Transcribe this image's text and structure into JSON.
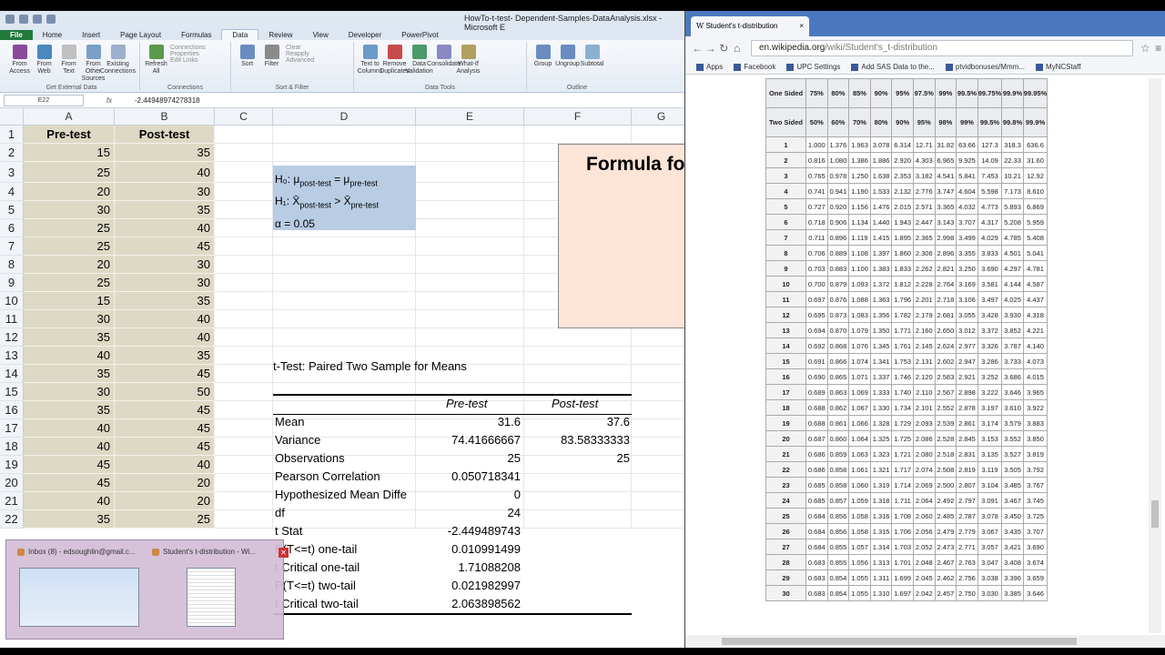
{
  "excel": {
    "title": "HowTo-t-test- Dependent-Samples-DataAnalysis.xlsx - Microsoft E",
    "tabs": [
      "File",
      "Home",
      "Insert",
      "Page Layout",
      "Formulas",
      "Data",
      "Review",
      "View",
      "Developer",
      "PowerPivot"
    ],
    "ribbon": {
      "get_external": [
        "From Access",
        "From Web",
        "From Text",
        "From Other Sources",
        "Existing Connections"
      ],
      "get_external_label": "Get External Data",
      "refresh": "Refresh All",
      "connections": [
        "Connections",
        "Properties",
        "Edit Links"
      ],
      "connections_label": "Connections",
      "sort": "Sort",
      "filter": "Filter",
      "filter_small": [
        "Clear",
        "Reapply",
        "Advanced"
      ],
      "sort_label": "Sort & Filter",
      "tools": [
        "Text to Columns",
        "Remove Duplicates",
        "Data Validation",
        "Consolidate",
        "What-If Analysis"
      ],
      "tools_label": "Data Tools",
      "outline": [
        "Group",
        "Ungroup",
        "Subtotal"
      ],
      "outline_label": "Outline"
    },
    "namebox": "E22",
    "fx": "fx",
    "formula": "-2.44948974278318",
    "columns": [
      "A",
      "B",
      "C",
      "D",
      "E",
      "F",
      "G"
    ],
    "rows": [
      "1",
      "2",
      "3",
      "4",
      "5",
      "6",
      "7",
      "8",
      "9",
      "10",
      "11",
      "12",
      "13",
      "14",
      "15",
      "16",
      "17",
      "18",
      "19",
      "20",
      "21",
      "22"
    ],
    "col_a_header": "Pre-test",
    "col_b_header": "Post-test",
    "pre": [
      "15",
      "25",
      "20",
      "30",
      "25",
      "25",
      "20",
      "25",
      "15",
      "30",
      "35",
      "40",
      "35",
      "30",
      "35",
      "40",
      "40",
      "45",
      "45",
      "40",
      "35"
    ],
    "post": [
      "35",
      "40",
      "30",
      "35",
      "40",
      "45",
      "30",
      "30",
      "35",
      "40",
      "40",
      "35",
      "45",
      "50",
      "45",
      "45",
      "45",
      "40",
      "20",
      "20",
      "25"
    ],
    "hyp": {
      "h0": "H₀: μ",
      "h0_sub1": "post-test",
      "h0_mid": " = μ",
      "h0_sub2": "pre-test",
      "h1": "H₁: X̄",
      "h1_sub1": "post-test",
      "h1_mid": " > X̄",
      "h1_sub2": "pre-test",
      "alpha": "α = 0.05"
    },
    "formula_box": "Formula for",
    "ttest_title": "t-Test: Paired Two Sample for Means",
    "ttest_cols": [
      "Pre-test",
      "Post-test"
    ],
    "ttest_rows": [
      {
        "label": "Mean",
        "pre": "31.6",
        "post": "37.6"
      },
      {
        "label": "Variance",
        "pre": "74.41666667",
        "post": "83.58333333"
      },
      {
        "label": "Observations",
        "pre": "25",
        "post": "25"
      },
      {
        "label": "Pearson Correlation",
        "pre": "0.050718341",
        "post": ""
      },
      {
        "label": "Hypothesized Mean Diffe",
        "pre": "0",
        "post": ""
      },
      {
        "label": "df",
        "pre": "24",
        "post": ""
      },
      {
        "label": "t Stat",
        "pre": "-2.449489743",
        "post": ""
      },
      {
        "label": "P(T<=t) one-tail",
        "pre": "0.010991499",
        "post": ""
      },
      {
        "label": "t Critical one-tail",
        "pre": "1.71088208",
        "post": ""
      },
      {
        "label": "P(T<=t) two-tail",
        "pre": "0.021982997",
        "post": ""
      },
      {
        "label": "t Critical two-tail",
        "pre": "2.063898562",
        "post": ""
      }
    ]
  },
  "taskbar_preview": [
    {
      "title": "Inbox (8) - edsoughlin@gmail.c..."
    },
    {
      "title": "Student's t-distribution - Wi..."
    }
  ],
  "chrome": {
    "tab_title": "Student's t-distribution",
    "url_domain": "en.wikipedia.org",
    "url_path": "/wiki/Student's_t-distribution",
    "bookmarks": [
      "Apps",
      "Facebook",
      "UPC Settings",
      "Add SAS Data to the...",
      "ptvidbonuses/Mmm...",
      "MyNCStaff"
    ],
    "one_sided_label": "One Sided",
    "two_sided_label": "Two Sided",
    "one_sided": [
      "75%",
      "80%",
      "85%",
      "90%",
      "95%",
      "97.5%",
      "99%",
      "99.5%",
      "99.75%",
      "99.9%",
      "99.95%"
    ],
    "two_sided": [
      "50%",
      "60%",
      "70%",
      "80%",
      "90%",
      "95%",
      "98%",
      "99%",
      "99.5%",
      "99.8%",
      "99.9%"
    ],
    "table": [
      [
        "1",
        "1.000",
        "1.376",
        "1.963",
        "3.078",
        "6.314",
        "12.71",
        "31.82",
        "63.66",
        "127.3",
        "318.3",
        "636.6"
      ],
      [
        "2",
        "0.816",
        "1.080",
        "1.386",
        "1.886",
        "2.920",
        "4.303",
        "6.965",
        "9.925",
        "14.09",
        "22.33",
        "31.60"
      ],
      [
        "3",
        "0.765",
        "0.978",
        "1.250",
        "1.638",
        "2.353",
        "3.182",
        "4.541",
        "5.841",
        "7.453",
        "10.21",
        "12.92"
      ],
      [
        "4",
        "0.741",
        "0.941",
        "1.190",
        "1.533",
        "2.132",
        "2.776",
        "3.747",
        "4.604",
        "5.598",
        "7.173",
        "8.610"
      ],
      [
        "5",
        "0.727",
        "0.920",
        "1.156",
        "1.476",
        "2.015",
        "2.571",
        "3.365",
        "4.032",
        "4.773",
        "5.893",
        "6.869"
      ],
      [
        "6",
        "0.718",
        "0.906",
        "1.134",
        "1.440",
        "1.943",
        "2.447",
        "3.143",
        "3.707",
        "4.317",
        "5.208",
        "5.959"
      ],
      [
        "7",
        "0.711",
        "0.896",
        "1.119",
        "1.415",
        "1.895",
        "2.365",
        "2.998",
        "3.499",
        "4.029",
        "4.785",
        "5.408"
      ],
      [
        "8",
        "0.706",
        "0.889",
        "1.108",
        "1.397",
        "1.860",
        "2.306",
        "2.896",
        "3.355",
        "3.833",
        "4.501",
        "5.041"
      ],
      [
        "9",
        "0.703",
        "0.883",
        "1.100",
        "1.383",
        "1.833",
        "2.262",
        "2.821",
        "3.250",
        "3.690",
        "4.297",
        "4.781"
      ],
      [
        "10",
        "0.700",
        "0.879",
        "1.093",
        "1.372",
        "1.812",
        "2.228",
        "2.764",
        "3.169",
        "3.581",
        "4.144",
        "4.587"
      ],
      [
        "11",
        "0.697",
        "0.876",
        "1.088",
        "1.363",
        "1.796",
        "2.201",
        "2.718",
        "3.106",
        "3.497",
        "4.025",
        "4.437"
      ],
      [
        "12",
        "0.695",
        "0.873",
        "1.083",
        "1.356",
        "1.782",
        "2.179",
        "2.681",
        "3.055",
        "3.428",
        "3.930",
        "4.318"
      ],
      [
        "13",
        "0.694",
        "0.870",
        "1.079",
        "1.350",
        "1.771",
        "2.160",
        "2.650",
        "3.012",
        "3.372",
        "3.852",
        "4.221"
      ],
      [
        "14",
        "0.692",
        "0.868",
        "1.076",
        "1.345",
        "1.761",
        "2.145",
        "2.624",
        "2.977",
        "3.326",
        "3.787",
        "4.140"
      ],
      [
        "15",
        "0.691",
        "0.866",
        "1.074",
        "1.341",
        "1.753",
        "2.131",
        "2.602",
        "2.947",
        "3.286",
        "3.733",
        "4.073"
      ],
      [
        "16",
        "0.690",
        "0.865",
        "1.071",
        "1.337",
        "1.746",
        "2.120",
        "2.583",
        "2.921",
        "3.252",
        "3.686",
        "4.015"
      ],
      [
        "17",
        "0.689",
        "0.863",
        "1.069",
        "1.333",
        "1.740",
        "2.110",
        "2.567",
        "2.898",
        "3.222",
        "3.646",
        "3.965"
      ],
      [
        "18",
        "0.688",
        "0.862",
        "1.067",
        "1.330",
        "1.734",
        "2.101",
        "2.552",
        "2.878",
        "3.197",
        "3.610",
        "3.922"
      ],
      [
        "19",
        "0.688",
        "0.861",
        "1.066",
        "1.328",
        "1.729",
        "2.093",
        "2.539",
        "2.861",
        "3.174",
        "3.579",
        "3.883"
      ],
      [
        "20",
        "0.687",
        "0.860",
        "1.064",
        "1.325",
        "1.725",
        "2.086",
        "2.528",
        "2.845",
        "3.153",
        "3.552",
        "3.850"
      ],
      [
        "21",
        "0.686",
        "0.859",
        "1.063",
        "1.323",
        "1.721",
        "2.080",
        "2.518",
        "2.831",
        "3.135",
        "3.527",
        "3.819"
      ],
      [
        "22",
        "0.686",
        "0.858",
        "1.061",
        "1.321",
        "1.717",
        "2.074",
        "2.508",
        "2.819",
        "3.119",
        "3.505",
        "3.792"
      ],
      [
        "23",
        "0.685",
        "0.858",
        "1.060",
        "1.319",
        "1.714",
        "2.069",
        "2.500",
        "2.807",
        "3.104",
        "3.485",
        "3.767"
      ],
      [
        "24",
        "0.685",
        "0.857",
        "1.059",
        "1.318",
        "1.711",
        "2.064",
        "2.492",
        "2.797",
        "3.091",
        "3.467",
        "3.745"
      ],
      [
        "25",
        "0.684",
        "0.856",
        "1.058",
        "1.316",
        "1.708",
        "2.060",
        "2.485",
        "2.787",
        "3.078",
        "3.450",
        "3.725"
      ],
      [
        "26",
        "0.684",
        "0.856",
        "1.058",
        "1.315",
        "1.706",
        "2.056",
        "2.479",
        "2.779",
        "3.067",
        "3.435",
        "3.707"
      ],
      [
        "27",
        "0.684",
        "0.855",
        "1.057",
        "1.314",
        "1.703",
        "2.052",
        "2.473",
        "2.771",
        "3.057",
        "3.421",
        "3.690"
      ],
      [
        "28",
        "0.683",
        "0.855",
        "1.056",
        "1.313",
        "1.701",
        "2.048",
        "2.467",
        "2.763",
        "3.047",
        "3.408",
        "3.674"
      ],
      [
        "29",
        "0.683",
        "0.854",
        "1.055",
        "1.311",
        "1.699",
        "2.045",
        "2.462",
        "2.756",
        "3.038",
        "3.396",
        "3.659"
      ],
      [
        "30",
        "0.683",
        "0.854",
        "1.055",
        "1.310",
        "1.697",
        "2.042",
        "2.457",
        "2.750",
        "3.030",
        "3.385",
        "3.646"
      ]
    ]
  },
  "colors": {
    "excel_green": "#1f7a3b",
    "cell_fill": "#ddd9c4",
    "hyp_fill": "#b8cce4",
    "formula_fill": "#fce4d6",
    "chrome_blue": "#4a78c0"
  }
}
